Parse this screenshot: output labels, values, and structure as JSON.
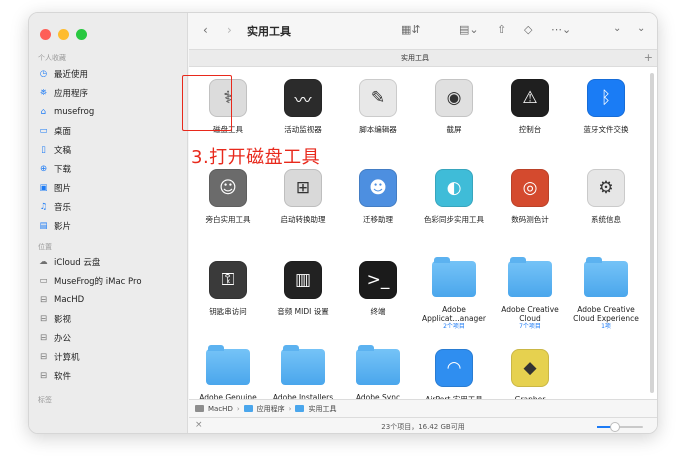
{
  "window": {
    "title": "实用工具",
    "tab_title": "实用工具",
    "new_tab": "+"
  },
  "sidebar": {
    "favorites_title": "个人收藏",
    "favorites": [
      {
        "label": "最近使用",
        "icon": "clock-icon"
      },
      {
        "label": "应用程序",
        "icon": "apps-icon"
      },
      {
        "label": "musefrog",
        "icon": "home-icon"
      },
      {
        "label": "桌面",
        "icon": "desktop-icon"
      },
      {
        "label": "文稿",
        "icon": "document-icon"
      },
      {
        "label": "下载",
        "icon": "download-icon"
      },
      {
        "label": "图片",
        "icon": "photo-icon"
      },
      {
        "label": "音乐",
        "icon": "music-icon"
      },
      {
        "label": "影片",
        "icon": "movie-icon"
      }
    ],
    "locations_title": "位置",
    "locations": [
      {
        "label": "iCloud 云盘",
        "icon": "cloud-icon"
      },
      {
        "label": "MuseFrog的 iMac Pro",
        "icon": "imac-icon"
      },
      {
        "label": "MacHD",
        "icon": "disk-icon"
      },
      {
        "label": "影视",
        "icon": "disk-icon"
      },
      {
        "label": "办公",
        "icon": "disk-icon"
      },
      {
        "label": "计算机",
        "icon": "disk-icon"
      },
      {
        "label": "软件",
        "icon": "disk-icon"
      }
    ],
    "tags_title": "标签"
  },
  "items": [
    {
      "label": "磁盘工具",
      "sub": "",
      "icon": "disk-utility-icon",
      "color": "#dcdcdc"
    },
    {
      "label": "活动监视器",
      "sub": "",
      "icon": "activity-monitor-icon",
      "color": "#2b2b2b"
    },
    {
      "label": "脚本编辑器",
      "sub": "",
      "icon": "script-editor-icon",
      "color": "#e8e8e8"
    },
    {
      "label": "截屏",
      "sub": "",
      "icon": "screenshot-icon",
      "color": "#e0e0e0"
    },
    {
      "label": "控制台",
      "sub": "",
      "icon": "console-icon",
      "color": "#1f1f1f"
    },
    {
      "label": "蓝牙文件交换",
      "sub": "",
      "icon": "bluetooth-icon",
      "color": "#1a7cf5"
    },
    {
      "label": "旁白实用工具",
      "sub": "",
      "icon": "voiceover-icon",
      "color": "#6b6b6b"
    },
    {
      "label": "启动转换助理",
      "sub": "",
      "icon": "boot-camp-icon",
      "color": "#d9d9d9"
    },
    {
      "label": "迁移助理",
      "sub": "",
      "icon": "migration-icon",
      "color": "#4d8fe0"
    },
    {
      "label": "色彩同步实用工具",
      "sub": "",
      "icon": "colorsync-icon",
      "color": "#3fbcd8"
    },
    {
      "label": "数码测色计",
      "sub": "",
      "icon": "color-meter-icon",
      "color": "#d44a2e"
    },
    {
      "label": "系统信息",
      "sub": "",
      "icon": "system-info-icon",
      "color": "#e6e6e6"
    },
    {
      "label": "钥匙串访问",
      "sub": "",
      "icon": "keychain-icon",
      "color": "#3a3a3a"
    },
    {
      "label": "音频 MIDI 设置",
      "sub": "",
      "icon": "midi-icon",
      "color": "#222222"
    },
    {
      "label": "终端",
      "sub": "",
      "icon": "terminal-icon",
      "color": "#1b1b1b"
    },
    {
      "label": "Adobe Applicat...anager",
      "sub": "2个项目",
      "icon": "folder-icon",
      "color": ""
    },
    {
      "label": "Adobe Creative Cloud",
      "sub": "7个项目",
      "icon": "folder-icon",
      "color": ""
    },
    {
      "label": "Adobe Creative Cloud Experience",
      "sub": "1项",
      "icon": "folder-icon",
      "color": ""
    },
    {
      "label": "Adobe Genuine",
      "sub": "",
      "icon": "folder-icon",
      "color": ""
    },
    {
      "label": "Adobe Installers",
      "sub": "",
      "icon": "folder-icon",
      "color": ""
    },
    {
      "label": "Adobe Sync",
      "sub": "",
      "icon": "folder-icon",
      "color": ""
    },
    {
      "label": "AirPort 实用工具",
      "sub": "",
      "icon": "airport-icon",
      "color": "#2f8ef0"
    },
    {
      "label": "Grapher",
      "sub": "",
      "icon": "grapher-icon",
      "color": "#e6d14f"
    }
  ],
  "annotation": "3.打开磁盘工具",
  "pathbar": [
    "MacHD",
    "应用程序",
    "实用工具"
  ],
  "status": "23个项目，16.42 GB可用",
  "zoom_level": 0.4,
  "accent": "#1d7bf5"
}
